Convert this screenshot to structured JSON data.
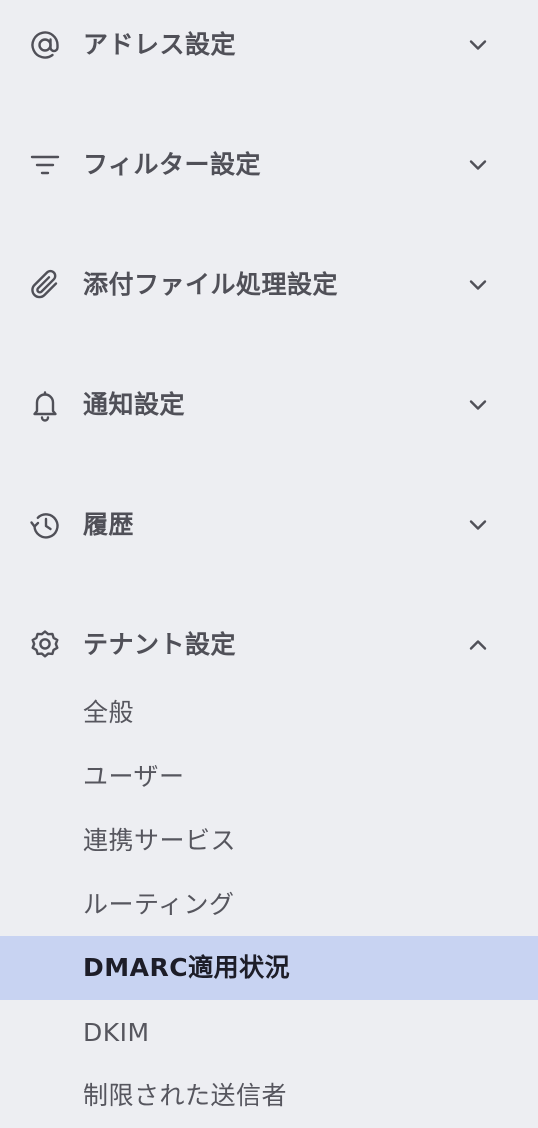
{
  "sections": [
    {
      "label": "アドレス設定",
      "icon": "at-sign-icon",
      "expanded": false
    },
    {
      "label": "フィルター設定",
      "icon": "filter-icon",
      "expanded": false
    },
    {
      "label": "添付ファイル処理設定",
      "icon": "paperclip-icon",
      "expanded": false
    },
    {
      "label": "通知設定",
      "icon": "bell-icon",
      "expanded": false
    },
    {
      "label": "履歴",
      "icon": "history-icon",
      "expanded": false
    },
    {
      "label": "テナント設定",
      "icon": "gear-icon",
      "expanded": true
    }
  ],
  "tenant_items": [
    {
      "label": "全般",
      "active": false
    },
    {
      "label": "ユーザー",
      "active": false
    },
    {
      "label": "連携サービス",
      "active": false
    },
    {
      "label": "ルーティング",
      "active": false
    },
    {
      "label": "DMARC適用状況",
      "active": true
    },
    {
      "label": "DKIM",
      "active": false
    },
    {
      "label": "制限された送信者",
      "active": false
    }
  ],
  "colors": {
    "background": "#edeef2",
    "active_background": "#c8d3f2",
    "text": "#505058",
    "active_text": "#1d1d28"
  }
}
